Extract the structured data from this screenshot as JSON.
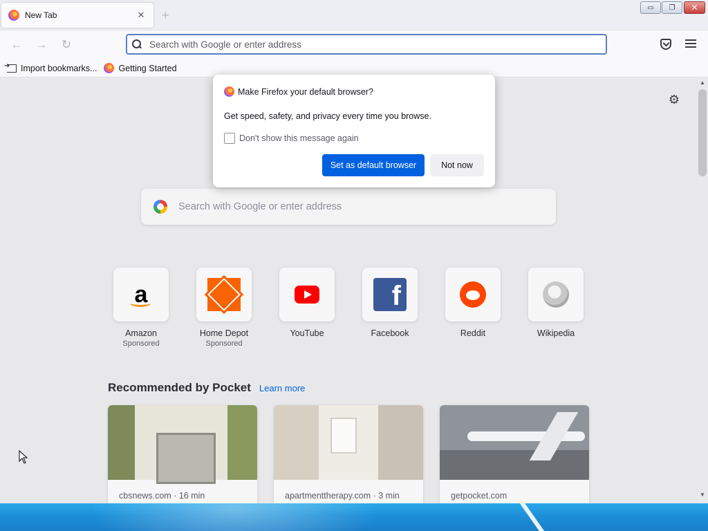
{
  "window": {
    "minimize_label": "▭",
    "maximize_label": "❐",
    "close_label": "✕"
  },
  "tab": {
    "title": "New Tab",
    "close_glyph": "✕",
    "new_tab_glyph": "+"
  },
  "nav": {
    "back_glyph": "←",
    "forward_glyph": "→",
    "reload_glyph": "↻",
    "urlbar_placeholder": "Search with Google or enter address"
  },
  "bookmarks": [
    {
      "label": "Import bookmarks...",
      "icon": "import-icon"
    },
    {
      "label": "Getting Started",
      "icon": "firefox-icon"
    }
  ],
  "newtab": {
    "settings_glyph": "⚙",
    "search_placeholder": "Search with Google or enter address",
    "top_sites": [
      {
        "name": "Amazon",
        "sub": "Sponsored",
        "icon": "amazon-icon"
      },
      {
        "name": "Home Depot",
        "sub": "Sponsored",
        "icon": "home-depot-icon"
      },
      {
        "name": "YouTube",
        "sub": "",
        "icon": "youtube-icon"
      },
      {
        "name": "Facebook",
        "sub": "",
        "icon": "facebook-icon"
      },
      {
        "name": "Reddit",
        "sub": "",
        "icon": "reddit-icon"
      },
      {
        "name": "Wikipedia",
        "sub": "",
        "icon": "wikipedia-icon"
      }
    ],
    "pocket": {
      "title": "Recommended by Pocket",
      "learn_more": "Learn more",
      "cards": [
        {
          "source": "cbsnews.com · 16 min"
        },
        {
          "source": "apartmenttherapy.com · 3 min"
        },
        {
          "source": "getpocket.com"
        }
      ]
    }
  },
  "dialog": {
    "title": "Make Firefox your default browser?",
    "body": "Get speed, safety, and privacy every time you browse.",
    "checkbox_label": "Don't show this message again",
    "checkbox_checked": false,
    "primary_button": "Set as default browser",
    "secondary_button": "Not now"
  },
  "colors": {
    "accent": "#0061e0",
    "urlbar_focus": "#5680c2",
    "taskbar": "#1c8fd8"
  }
}
